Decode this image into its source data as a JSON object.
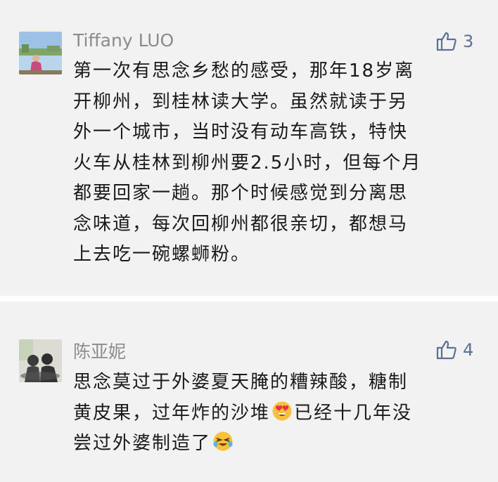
{
  "comments": [
    {
      "author": "Tiffany LUO",
      "likes": "3",
      "lines": [
        "第一次有思念乡愁的感受，那年18岁离",
        "开柳州，到桂林读大学。虽然就读于另",
        "外一个城市，当时没有动车高铁，特快",
        "火车从桂林到柳州要2.5小时，但每个月",
        "都要回家一趟。那个时候感觉到分离思",
        "念味道，每次回柳州都很亲切，都想马",
        "上去吃一碗螺蛳粉。"
      ]
    },
    {
      "author": "陈亚妮",
      "likes": "4",
      "lines": [
        "思念莫过于外婆夏天腌的糟辣酸，糖制",
        "黄皮果，过年炸的沙堆",
        "已经十几年没",
        "尝过外婆制造了"
      ],
      "emojis": [
        "heart-eyes-emoji",
        "crying-laughing-emoji"
      ]
    }
  ],
  "colors": {
    "background": "#f2f2f2",
    "author": "#8c8c8c",
    "like_accent": "#5e6f94",
    "body_text": "#1a1a1a"
  }
}
